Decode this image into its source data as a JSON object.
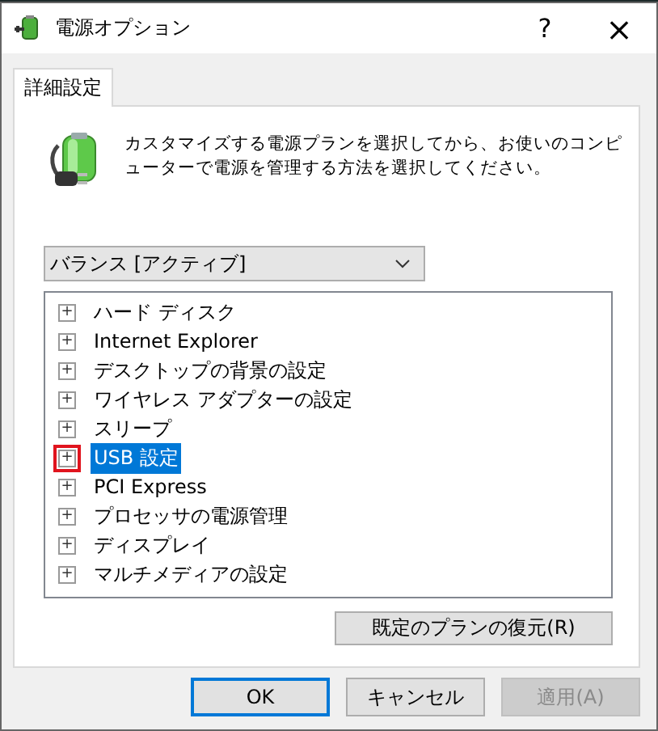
{
  "window": {
    "title": "電源オプション",
    "help": "?",
    "close": "×"
  },
  "tabs": [
    {
      "label": "詳細設定",
      "selected": true
    }
  ],
  "description": "カスタマイズする電源プランを選択してから、お使いのコンピューターで電源を管理する方法を選択してください。",
  "plan_dropdown": {
    "value": "バランス [アクティブ]"
  },
  "tree": {
    "items": [
      {
        "label": "ハード ディスク",
        "expander": "+",
        "selected": false,
        "highlighted": false
      },
      {
        "label": "Internet Explorer",
        "expander": "+",
        "selected": false,
        "highlighted": false
      },
      {
        "label": "デスクトップの背景の設定",
        "expander": "+",
        "selected": false,
        "highlighted": false
      },
      {
        "label": "ワイヤレス アダプターの設定",
        "expander": "+",
        "selected": false,
        "highlighted": false
      },
      {
        "label": "スリープ",
        "expander": "+",
        "selected": false,
        "highlighted": false
      },
      {
        "label": "USB 設定",
        "expander": "+",
        "selected": true,
        "highlighted": true
      },
      {
        "label": "PCI Express",
        "expander": "+",
        "selected": false,
        "highlighted": false
      },
      {
        "label": "プロセッサの電源管理",
        "expander": "+",
        "selected": false,
        "highlighted": false
      },
      {
        "label": "ディスプレイ",
        "expander": "+",
        "selected": false,
        "highlighted": false
      },
      {
        "label": "マルチメディアの設定",
        "expander": "+",
        "selected": false,
        "highlighted": false
      }
    ]
  },
  "restore_button": "既定のプランの復元(R)",
  "buttons": [
    {
      "label": "OK",
      "default": true,
      "disabled": false
    },
    {
      "label": "キャンセル",
      "default": false,
      "disabled": false
    },
    {
      "label": "適用(A)",
      "default": false,
      "disabled": true
    }
  ]
}
